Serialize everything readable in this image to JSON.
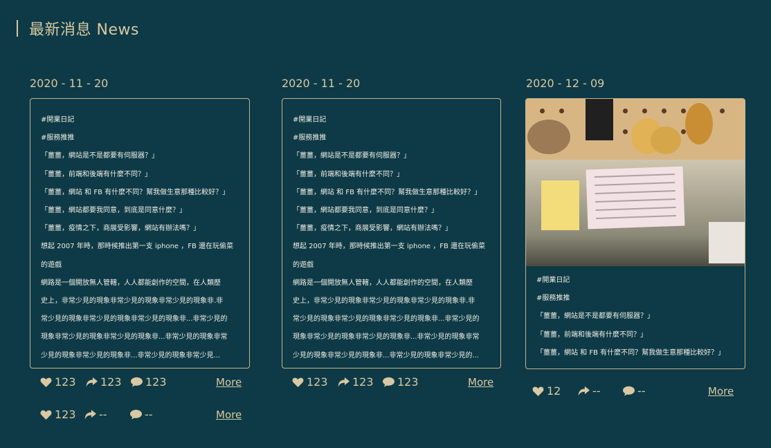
{
  "header": {
    "title": "最新消息 News"
  },
  "cards": [
    {
      "date": "2020 - 11 - 20",
      "lines": [
        "#開業日記",
        "#服務推推",
        "「薑薑，網站是不是都要有伺服器？」",
        "「薑薑，前端和後端有什麼不同？」",
        "「薑薑，網站 和 FB 有什麼不同？幫我做生意那種比較好？」",
        "「薑薑，網站都要我同意，到底是同意什麼？」",
        "「薑薑，疫情之下，商展受影響，網站有辦法嗎？」",
        "想起 2007 年時，那時候推出第一支 iphone ，FB 還在玩偷菜",
        "的遊戲",
        "網路是一個開放無人管轄，人人都能創作的空間，在人類歷",
        "史上，非常少見的現象非常少見的現象非常少見的現象非.非",
        "常少見的現象非常少見的現象非常少見的現象非...非常少見的",
        "現象非常少見的現象非常少見的現象非...非常少見的現象非常",
        "少見的現象非常少見的現象非...非常少見的現象非常少見..."
      ],
      "stats": [
        {
          "likes": "123",
          "shares": "123",
          "comments": "123",
          "more": "More"
        },
        {
          "likes": "123",
          "shares": "--",
          "comments": "--",
          "more": "More"
        }
      ]
    },
    {
      "date": "2020 - 11 - 20",
      "lines": [
        "#開業日記",
        "#服務推推",
        "「薑薑，網站是不是都要有伺服器？」",
        "「薑薑，前端和後端有什麼不同？」",
        "「薑薑，網站 和 FB 有什麼不同？幫我做生意那種比較好？」",
        "「薑薑，網站都要我同意，到底是同意什麼？」",
        "「薑薑，疫情之下，商展受影響，網站有辦法嗎？」",
        "想起 2007 年時，那時候推出第一支 iphone ，FB 還在玩偷菜",
        "的遊戲",
        "網路是一個開放無人管轄，人人都能創作的空間，在人類歷",
        "史上，非常少見的現象非常少見的現象非常少見的現象非.非",
        "常少見的現象非常少見的現象非常少見的現象非...非常少見的",
        "現象非常少見的現象非常少見的現象非...非常少見的現象非常",
        "少見的現象非常少見的現象非...非常少見的現象非常少見的..."
      ],
      "stats": [
        {
          "likes": "123",
          "shares": "123",
          "comments": "123",
          "more": "More"
        }
      ]
    },
    {
      "date": "2020 - 12 - 09",
      "lines": [
        "#開業日記",
        "#服務推推",
        "「薑薑，網站是不是都要有伺服器？」",
        "「薑薑，前端和後端有什麼不同？」",
        "「薑薑，網站 和 FB 有什麼不同？幫我做生意那種比較好？」"
      ],
      "stats": [
        {
          "likes": "12",
          "shares": "--",
          "comments": "--",
          "more": "More"
        }
      ]
    }
  ]
}
